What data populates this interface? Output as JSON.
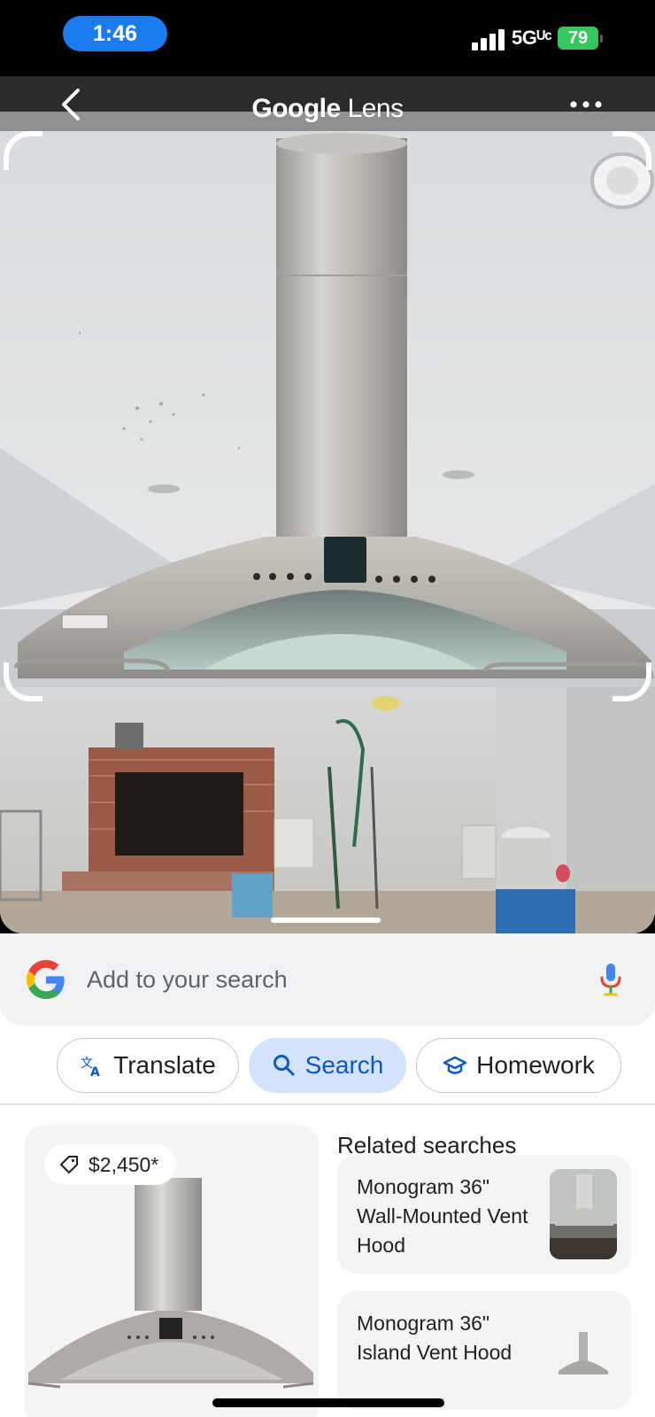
{
  "status_bar": {
    "time": "1:46",
    "network": "5Gᵁᶜ",
    "battery": "79",
    "battery_color": "#34c759",
    "time_pill_color": "#1a7cf0"
  },
  "header": {
    "title_google": "Google",
    "title_lens": "Lens",
    "back_icon": "chevron-left-icon",
    "more_icon": "more-horizontal-icon"
  },
  "search": {
    "placeholder": "Add to your search",
    "logo_icon": "google-g-icon",
    "mic_icon": "microphone-icon"
  },
  "chips": [
    {
      "label": "Translate",
      "icon": "translate-icon",
      "active": false
    },
    {
      "label": "Search",
      "icon": "search-icon",
      "active": true
    },
    {
      "label": "Homework",
      "icon": "graduation-cap-icon",
      "active": false
    }
  ],
  "product": {
    "price": "$2,450*",
    "price_icon": "price-tag-icon"
  },
  "related": {
    "title": "Related searches",
    "items": [
      {
        "label": "Monogram 36\" Wall-Mounted Vent Hood"
      },
      {
        "label": "Monogram 36\" Island Vent Hood"
      }
    ]
  },
  "colors": {
    "accent_blue": "#0b57d0",
    "chip_active_bg": "#d3e3fd",
    "sheet_bg": "#f0f2f4"
  }
}
